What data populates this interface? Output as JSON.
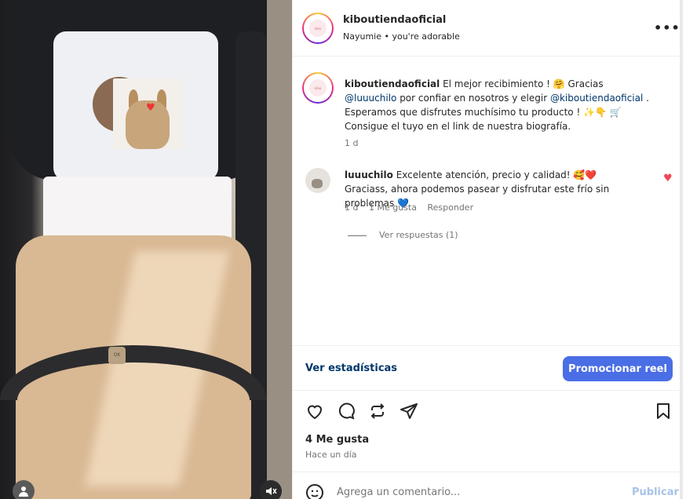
{
  "header": {
    "username": "kiboutiendaoficial",
    "audio": "Nayumie • you're adorable",
    "more_icon": "more-dots-icon"
  },
  "media": {
    "brand_tag": "OK",
    "avatar_icon": "user-icon",
    "mute_icon": "muted-speaker-icon"
  },
  "caption": {
    "username": "kiboutiendaoficial",
    "text_1": " El mejor recibimiento ! 🤗 Gracias ",
    "mention_1": "@luuuchilo",
    "text_2": " por confiar en nosotros y elegir ",
    "mention_2": "@kiboutiendaoficial",
    "text_3": " . Esperamos que disfrutes muchísimo tu producto ! ✨👇 🛒Consigue el tuyo en el link de nuestra biografía.",
    "time": "1 d"
  },
  "reply_comment": {
    "username": "luuuchilo",
    "text": " Excelente atención, precio y calidad! 🥰❤️ Graciass, ahora podemos pasear y disfrutar este frío sin problemas 💙",
    "time": "1 d",
    "likes": "1 Me gusta",
    "reply_label": "Responder",
    "view_replies": "Ver respuestas (1)"
  },
  "stats": {
    "view_stats": "Ver estadísticas",
    "promote": "Promocionar reel"
  },
  "actions": {
    "likes": "4 Me gusta",
    "ago": "Hace un día"
  },
  "composer": {
    "placeholder": "Agrega un comentario...",
    "publish": "Publicar"
  },
  "colors": {
    "accent": "#4a6ee6",
    "link": "#00376b",
    "like_red": "#ed4956"
  }
}
